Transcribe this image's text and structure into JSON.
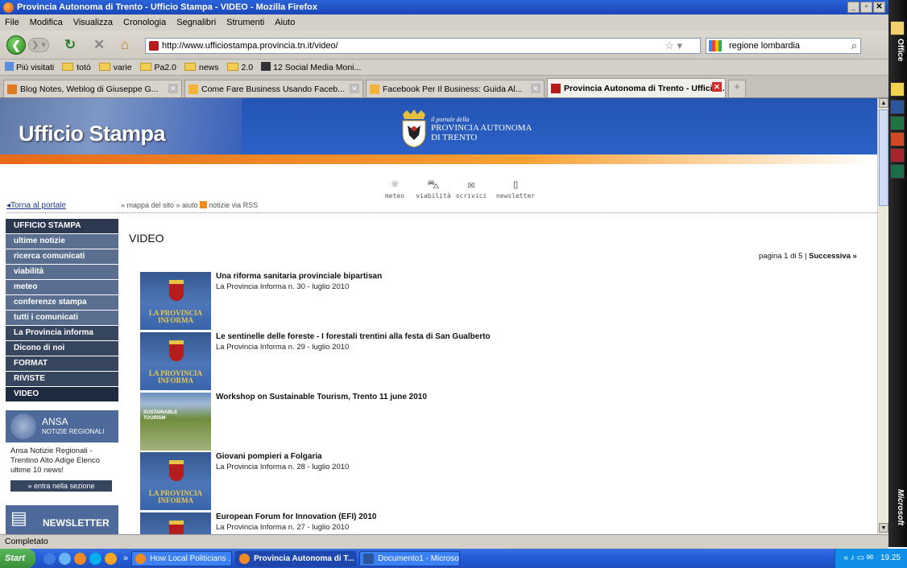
{
  "window": {
    "title": "Provincia Autonoma di Trento - Ufficio Stampa - VIDEO - Mozilla Firefox"
  },
  "menu": [
    "File",
    "Modifica",
    "Visualizza",
    "Cronologia",
    "Segnalibri",
    "Strumenti",
    "Aiuto"
  ],
  "navbar": {
    "url": "http://www.ufficiostampa.provincia.tn.it/video/",
    "search_value": "regione lombardia"
  },
  "bookmarks": [
    "Più visitati",
    "totò",
    "varie",
    "Pa2.0",
    "news",
    "2.0",
    "12 Social Media Moni..."
  ],
  "tabs": [
    {
      "label": "Blog Notes, Weblog di Giuseppe G..."
    },
    {
      "label": "Come Fare Business Usando Faceb..."
    },
    {
      "label": "Facebook Per Il Business: Guida Al..."
    },
    {
      "label": "Provincia Autonoma di Trento - Ufficio..."
    }
  ],
  "banner": {
    "title": "Ufficio Stampa",
    "portal_small": "il portale della",
    "portal_line1": "PROVINCIA AUTONOMA",
    "portal_line2": "DI TRENTO"
  },
  "toolbar": [
    "meteo",
    "viabilità",
    "scrivici",
    "newsletter"
  ],
  "links": {
    "torna": "Torna al portale",
    "mappa": "» mappa del sito  » aiuto",
    "rss": "notizie via RSS"
  },
  "sidebar": [
    {
      "label": "UFFICIO STAMPA"
    },
    {
      "label": "ultime notizie"
    },
    {
      "label": "ricerca comunicati"
    },
    {
      "label": "viabilità"
    },
    {
      "label": "meteo"
    },
    {
      "label": "conferenze stampa"
    },
    {
      "label": "tutti i comunicati"
    },
    {
      "label": "La Provincia informa"
    },
    {
      "label": "Dicono di noi"
    },
    {
      "label": "FORMAT"
    },
    {
      "label": "RIVISTE"
    },
    {
      "label": "VIDEO"
    }
  ],
  "ansa": {
    "title": "ANSA",
    "subtitle": "NOTIZIE REGIONALI",
    "text": "Ansa Notizie Regionali - Trentino Alto Adige Elenco ultime 10 news!",
    "button": "» entra nella sezione"
  },
  "newsletter": {
    "label": "NEWSLETTER"
  },
  "main": {
    "title": "VIDEO",
    "pager_prefix": "pagina 1 di 5 | ",
    "pager_next": "Successiva »",
    "thumb_label": "LA PROVINCIA INFORMA",
    "photo_caption": "SUSTAINABLE TOURISM",
    "videos": [
      {
        "title": "Una riforma sanitaria provinciale bipartisan",
        "sub": "La Provincia Informa n. 30 - luglio 2010"
      },
      {
        "title": "Le sentinelle delle foreste - I forestali trentini alla festa di San Gualberto",
        "sub": "La Provincia Informa n. 29 - luglio 2010"
      },
      {
        "title": "Workshop on Sustainable Tourism, Trento 11 june 2010",
        "sub": ""
      },
      {
        "title": "Giovani pompieri a Folgaria",
        "sub": "La Provincia Informa n. 28 - luglio 2010"
      },
      {
        "title": "European Forum for Innovation (EFI) 2010",
        "sub": "La Provincia Informa n. 27 - luglio 2010"
      }
    ]
  },
  "status": "Completato",
  "taskbar": {
    "start": "Start",
    "items": [
      "How Local Politicians ...",
      "Provincia Autonoma di T...",
      "Documento1 - Microso..."
    ],
    "clock": "19.25"
  },
  "officebar": {
    "top_label": "Office",
    "bottom_label": "Microsoft"
  }
}
